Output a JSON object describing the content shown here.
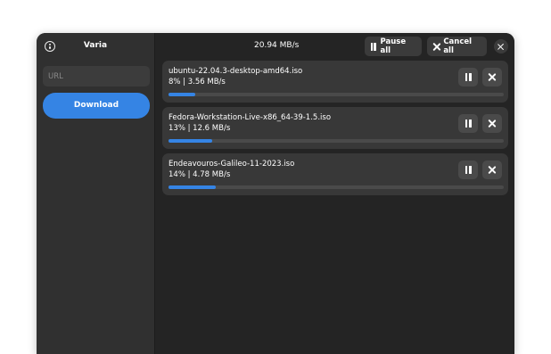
{
  "app": {
    "title": "Varia"
  },
  "sidebar": {
    "url_placeholder": "URL",
    "url_value": "",
    "download_label": "Download"
  },
  "header": {
    "total_speed": "20.94 MB/s",
    "pause_all_label": "Pause all",
    "cancel_all_label": "Cancel all"
  },
  "downloads": [
    {
      "name": "ubuntu-22.04.3-desktop-amd64.iso",
      "status": "8%  |  3.56 MB/s",
      "progress": 0.08
    },
    {
      "name": "Fedora-Workstation-Live-x86_64-39-1.5.iso",
      "status": "13%  |  12.6 MB/s",
      "progress": 0.13
    },
    {
      "name": "Endeavouros-Galileo-11-2023.iso",
      "status": "14%  |  4.78 MB/s",
      "progress": 0.14
    }
  ],
  "colors": {
    "accent": "#3584e4",
    "window_bg": "#242424",
    "sidebar_bg": "#303030",
    "card_bg": "#383838"
  },
  "icons": {
    "info": "info-icon",
    "pause": "pause-icon",
    "cancel": "x-icon",
    "close": "close-icon"
  }
}
